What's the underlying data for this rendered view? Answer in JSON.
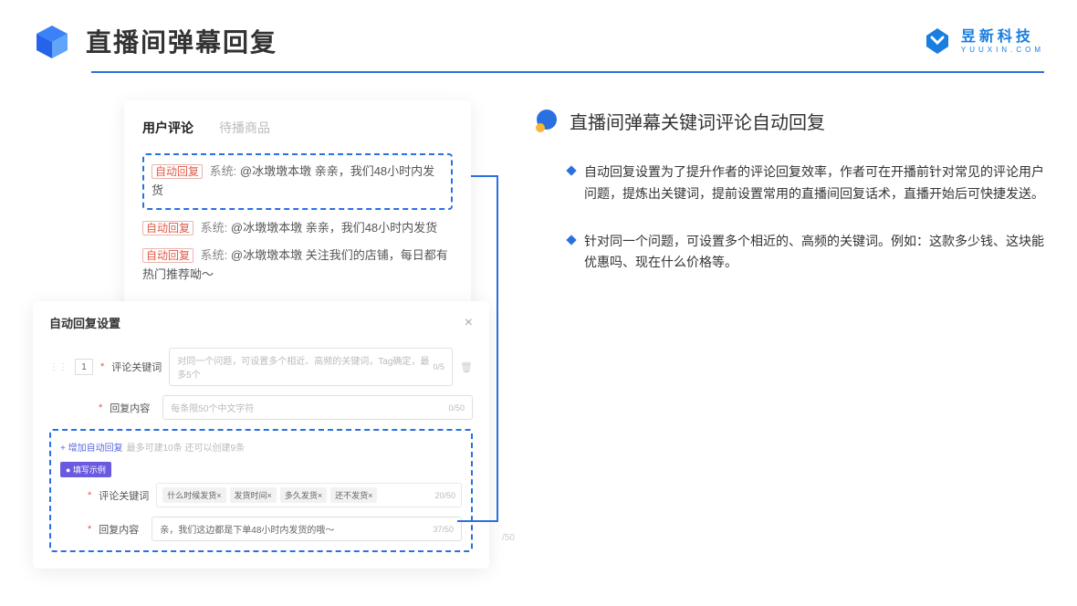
{
  "header": {
    "title": "直播间弹幕回复",
    "brand_cn": "昱新科技",
    "brand_en": "YUUXIN.COM"
  },
  "comments_card": {
    "tab_active": "用户评论",
    "tab_inactive": "待播商品",
    "auto_tag": "自动回复",
    "sys_prefix": "系统:",
    "row1": "@冰墩墩本墩 亲亲，我们48小时内发货",
    "row2": "@冰墩墩本墩 亲亲，我们48小时内发货",
    "row3": "@冰墩墩本墩 关注我们的店铺，每日都有热门推荐呦～"
  },
  "settings_card": {
    "title": "自动回复设置",
    "idx": "1",
    "label_keyword": "评论关键词",
    "placeholder_keyword": "对同一个问题，可设置多个相近、高频的关键词，Tag确定，最多5个",
    "count_keyword": "0/5",
    "label_content": "回复内容",
    "placeholder_content": "每条限50个中文字符",
    "count_content": "0/50",
    "add_text": "+ 增加自动回复",
    "add_hint": "最多可建10条 还可以创建9条",
    "example_badge": "● 填写示例",
    "ex_label_keyword": "评论关键词",
    "ex_tags": [
      "什么时候发货×",
      "发货时间×",
      "多久发货×",
      "还不发货×"
    ],
    "ex_count_keyword": "20/50",
    "ex_label_content": "回复内容",
    "ex_content_value": "亲，我们这边都是下单48小时内发货的哦～",
    "ex_count_content": "37/50",
    "outside_count": "/50"
  },
  "right": {
    "feature_title": "直播间弹幕关键词评论自动回复",
    "bullet1": "自动回复设置为了提升作者的评论回复效率，作者可在开播前针对常见的评论用户问题，提炼出关键词，提前设置常用的直播间回复话术，直播开始后可快捷发送。",
    "bullet2": "针对同一个问题，可设置多个相近的、高频的关键词。例如：这款多少钱、这块能优惠吗、现在什么价格等。"
  }
}
